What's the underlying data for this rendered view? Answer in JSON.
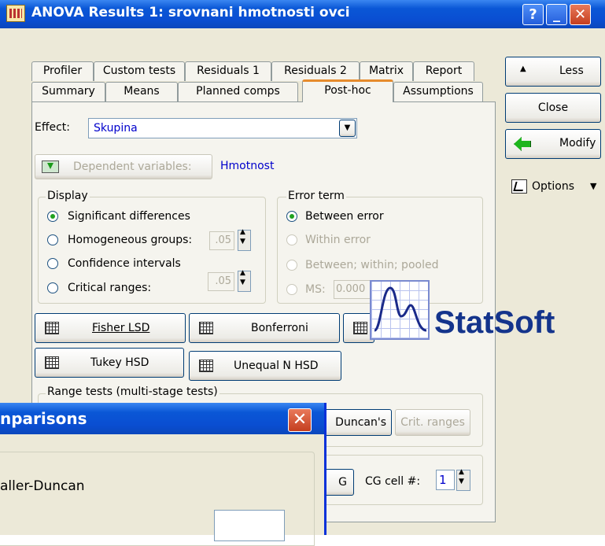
{
  "window": {
    "title": "ANOVA Results 1: srovnani hmotnosti ovci"
  },
  "titlebar_buttons": {
    "help": "?",
    "minimize": "_",
    "close": "✕"
  },
  "tabs_row1": [
    "Profiler",
    "Custom tests",
    "Residuals 1",
    "Residuals 2",
    "Matrix",
    "Report"
  ],
  "tabs_row2": [
    "Summary",
    "Means",
    "Planned comps",
    "Post-hoc",
    "Assumptions"
  ],
  "active_tab": "Post-hoc",
  "effect": {
    "label": "Effect:",
    "value": "Skupina"
  },
  "dependent": {
    "button_label": "Dependent variables:",
    "value": "Hmotnost"
  },
  "display": {
    "title": "Display",
    "options": [
      "Significant differences",
      "Homogeneous groups:",
      "Confidence intervals",
      "Critical ranges:"
    ],
    "selected": "Significant differences",
    "homog_value": ".05",
    "critical_value": ".05"
  },
  "error_term": {
    "title": "Error term",
    "options": [
      "Between error",
      "Within error",
      "Between; within; pooled",
      "MS:"
    ],
    "selected": "Between error",
    "ms_value": "0.000"
  },
  "tests": {
    "fisher": "Fisher LSD",
    "bonferroni": "Bonferroni",
    "tukey": "Tukey HSD",
    "unequal": "Unequal N HSD"
  },
  "range_tests": {
    "title": "Range tests (multi-stage tests)",
    "duncan": "Duncan's",
    "crit_ranges": "Crit. ranges"
  },
  "cg": {
    "button_tail": "G",
    "label": "CG cell #:",
    "value": "1"
  },
  "side": {
    "less": "Less",
    "close": "Close",
    "modify": "Modify",
    "options": "Options"
  },
  "logo": {
    "text": "StatSoft"
  },
  "dialog": {
    "title_fragment": "nparisons",
    "item_fragment": "aller-Duncan",
    "close": "✕"
  }
}
